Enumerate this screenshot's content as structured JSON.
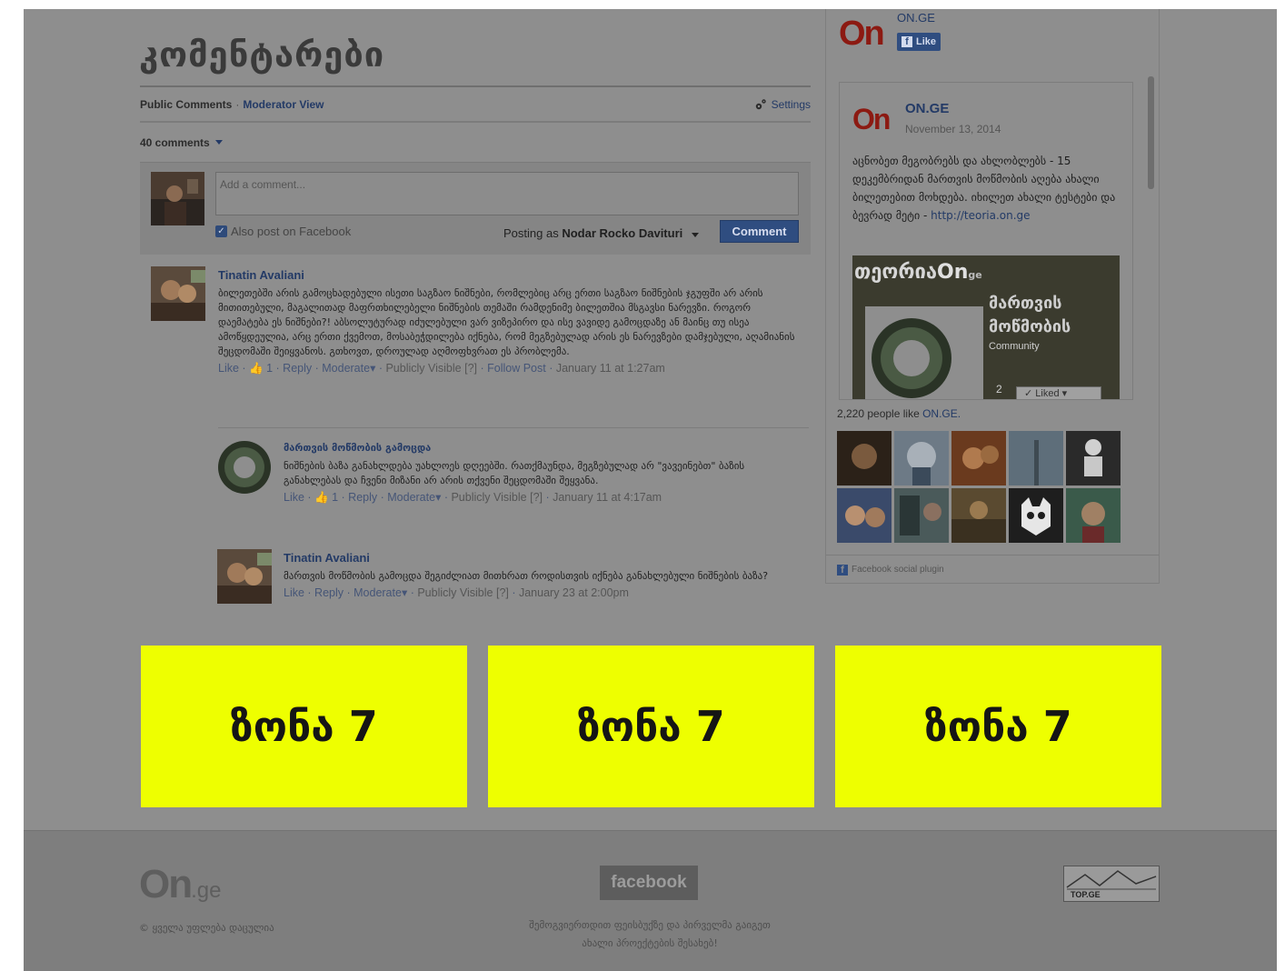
{
  "page": {
    "title": "კომენტარები"
  },
  "fb_comments": {
    "tab_public": "Public Comments",
    "tab_separator": "·",
    "tab_moderator": "Moderator View",
    "settings_label": "Settings",
    "count_label": "40 comments",
    "compose": {
      "placeholder": "Add a comment...",
      "also_post": "Also post on Facebook",
      "posting_as_prefix": "Posting as",
      "posting_as_name": "Nodar Rocko Davituri",
      "comment_button": "Comment"
    },
    "comments": [
      {
        "author": "Tinatin Avaliani",
        "body": "ბილეთებში არის გამოცხადებული ისეთი საგზაო ნიშნები, რომლებიც არც ერთი საგზაო ნიშნების ჯგუფში არ არის მითითებული, მაგალითად მაფრთხილებელი ნიშნების თემაში რამდენიმე ბილეთშია მსგავსი ნარევზი. როგორ დაემატება ეს ნიშნები?! აბსოლუტურად იძულებული ვარ ვიზეპირო და ისე ვავიდე გამოცდაზე ან მაინც თუ ისეა ამოწყდეულია, არც ერთი ქვემოთ, მოსაბეჭდილება იქნება, რომ მეგზებულად არის ეს ნარევზები დამჯებული, აღამიანის შეცდომაში შეიყვანოს. გთხოვთ, დროულად აღმოფხვრათ ეს პრობლემა.",
        "meta": {
          "like": "Like",
          "likes_count": "1",
          "reply": "Reply",
          "moderate": "Moderate",
          "visibility": "Publicly Visible",
          "visibility_hint": "[?]",
          "follow": "Follow Post",
          "time": "January 11 at 1:27am"
        }
      },
      {
        "author": "მართვის მოწმობის გამოცდა",
        "body": "ნიშნების ბაზა განახლდება უახლოეს დღეებში. რათქმაუნდა, მეგზებულად არ \"ვავეინებთ\" ბაზის განახლებას და ჩვენი მიზანი არ არის თქვენი შეცდომაში შეყვანა.",
        "meta": {
          "like": "Like",
          "likes_count": "1",
          "reply": "Reply",
          "moderate": "Moderate",
          "visibility": "Publicly Visible",
          "visibility_hint": "[?]",
          "time": "January 11 at 4:17am"
        }
      },
      {
        "author": "Tinatin Avaliani",
        "body": "მართვის მოწმობის გამოცდა შეგიძლიათ მითხრათ როდისთვის იქნება განახლებული ნიშნების ბაზა?",
        "meta": {
          "like": "Like",
          "reply": "Reply",
          "moderate": "Moderate",
          "visibility": "Publicly Visible",
          "visibility_hint": "[?]",
          "time": "January 23 at 2:00pm"
        }
      }
    ]
  },
  "sidebar": {
    "page_name": "ON.GE",
    "logo_text": "On",
    "like_label": "Like",
    "post": {
      "author": "ON.GE",
      "date": "November 13, 2014",
      "text": "აცნობეთ მეგობრებს და ახლობლებს - 15 დეკემბრიდან მართვის მოწმობის აღება ახალი ბილეთებით მოხდება. იხილეთ ახალი ტესტები და ბევრად მეტი -",
      "link": "http://teoria.on.ge",
      "image_brand": "თეორია",
      "image_brand_logo": "On",
      "image_brand_suffix": "ge",
      "image_title_line1": "მართვის",
      "image_title_line2": "მოწმობის",
      "image_subtitle": "Community",
      "liked_label": "✓ Liked ▾",
      "partial_count": "2"
    },
    "likes_text": "2,220 people like",
    "likes_link": "ON.GE.",
    "plugin_label": "Facebook social plugin"
  },
  "zones": [
    "ზონა 7",
    "ზონა 7",
    "ზონა 7"
  ],
  "footer": {
    "logo_main": "On",
    "logo_suffix": ".ge",
    "copyright": "© ყველა უფლება დაცულია",
    "facebook_label": "facebook",
    "facebook_text_line1": "შემოგვიერთდით ფეისბუქზე და პირველმა გაიგეთ",
    "facebook_text_line2": "ახალი პროექტების შესახებ!",
    "top_ge_label": "TOP.GE"
  },
  "colors": {
    "zone": "#eeff00",
    "fb_blue": "#2f4d80",
    "brand_red": "#8c1a12"
  }
}
